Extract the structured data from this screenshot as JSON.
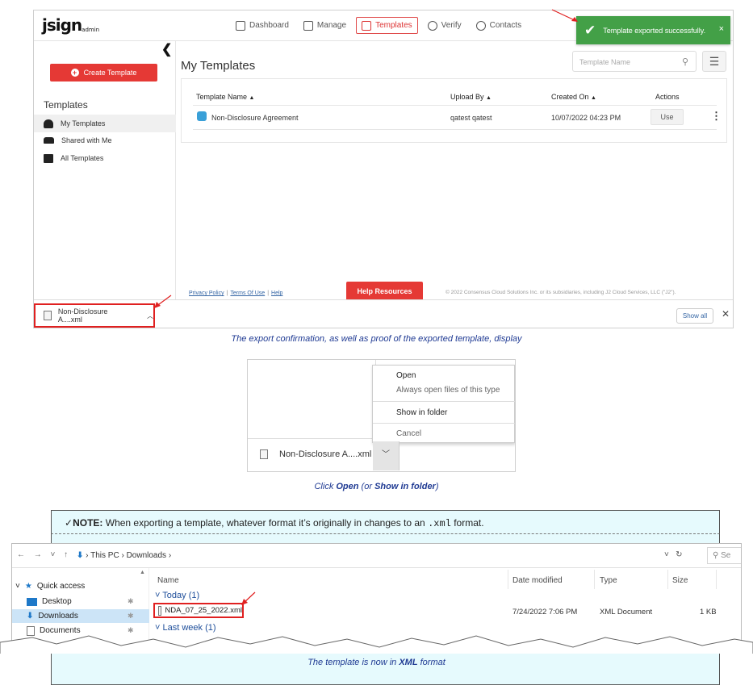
{
  "app": {
    "logo_main": "jsign",
    "logo_sub": "admin",
    "nav": [
      {
        "label": "Dashboard",
        "icon": "dashboard-icon"
      },
      {
        "label": "Manage",
        "icon": "clipboard-icon"
      },
      {
        "label": "Templates",
        "icon": "template-icon",
        "active": true
      },
      {
        "label": "Verify",
        "icon": "verify-icon"
      },
      {
        "label": "Contacts",
        "icon": "contacts-icon"
      }
    ],
    "toast": {
      "message": "Template exported successfully.",
      "close": "×"
    },
    "sidebar": {
      "collapse": "❮",
      "create_button": "Create Template",
      "section_title": "Templates",
      "items": [
        {
          "label": "My Templates",
          "icon": "person-icon"
        },
        {
          "label": "Shared with Me",
          "icon": "group-icon"
        },
        {
          "label": "All Templates",
          "icon": "all-templates-icon"
        }
      ]
    },
    "main": {
      "title": "My Templates",
      "search_placeholder": "Template Name",
      "columns": {
        "name": "Template Name",
        "upload_by": "Upload By",
        "created_on": "Created On",
        "actions": "Actions"
      },
      "rows": [
        {
          "name": "Non-Disclosure Agreement",
          "upload_by": "qatest qatest",
          "created_on": "10/07/2022 04:23 PM",
          "action": "Use"
        }
      ]
    },
    "footer": {
      "privacy": "Privacy Policy",
      "terms": "Terms Of Use",
      "help": "Help",
      "help_button": "Help Resources",
      "copyright": "© 2022 Consensus Cloud Solutions Inc. or its subsidiaries, including J2 Cloud Services, LLC (\"J2\")."
    },
    "download_bar": {
      "file": "Non-Disclosure A....xml",
      "show_all": "Show all",
      "close": "✕"
    }
  },
  "caption1": "The export confirmation, as well as proof of the exported template, display",
  "menu": {
    "items": [
      "Open",
      "Always open files of this type",
      "Show in folder",
      "Cancel"
    ],
    "file": "Non-Disclosure A....xml"
  },
  "caption2": {
    "pre": "Click ",
    "b1": "Open",
    "mid": " (or ",
    "b2": "Show in folder",
    "post": ")"
  },
  "note": {
    "label": "NOTE:",
    "text": " When exporting a template, whatever format it’s originally in changes to an ",
    "code": ".xml",
    "end": " format."
  },
  "explorer": {
    "path": [
      "This PC",
      "Downloads"
    ],
    "search": "Se",
    "sidebar": [
      {
        "label": "Quick access"
      },
      {
        "label": "Desktop"
      },
      {
        "label": "Downloads"
      },
      {
        "label": "Documents"
      }
    ],
    "columns": {
      "name": "Name",
      "date": "Date modified",
      "type": "Type",
      "size": "Size"
    },
    "groups": [
      "Today (1)",
      "Last week (1)"
    ],
    "file": {
      "name": "NDA_07_25_2022.xml",
      "date": "7/24/2022 7:06 PM",
      "type": "XML Document",
      "size": "1 KB"
    }
  },
  "caption3": {
    "pre": "The template is now in ",
    "b": "XML",
    "post": " format"
  },
  "colors": {
    "accent": "#e53935",
    "toast": "#43a047",
    "caption": "#1f3a93",
    "note_bg": "#e6fafd"
  }
}
